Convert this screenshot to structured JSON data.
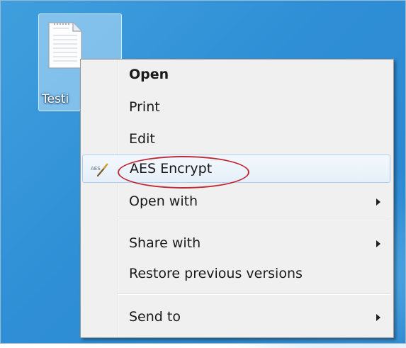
{
  "desktop": {
    "file": {
      "label": "Testi",
      "icon": "text-document-icon"
    }
  },
  "context_menu": {
    "items": [
      {
        "label": "Open",
        "bold": true
      },
      {
        "label": "Print"
      },
      {
        "label": "Edit"
      },
      {
        "label": "AES Encrypt",
        "icon": "aes-encrypt-icon",
        "icon_text": "AES",
        "highlighted": true
      },
      {
        "label": "Open with",
        "submenu": true
      },
      {
        "label": "Share with",
        "submenu": true
      },
      {
        "label": "Restore previous versions"
      },
      {
        "label": "Send to",
        "submenu": true
      }
    ]
  },
  "annotation": {
    "color": "#c02a35",
    "target": "AES Encrypt"
  }
}
